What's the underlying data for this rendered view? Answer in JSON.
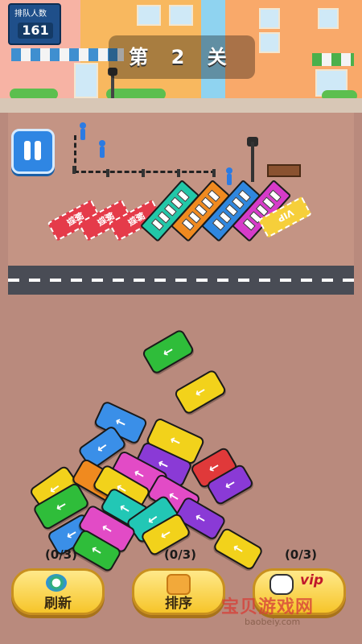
{
  "hud": {
    "queue_label": "排队人数",
    "queue_count": "161",
    "level_title": "第 2 关"
  },
  "parking": {
    "locked_slots": [
      "解锁",
      "解锁",
      "解锁"
    ],
    "bus_colors": [
      "#22c7a8",
      "#f08a1f",
      "#2f87df",
      "#d63bc9"
    ],
    "vip_slot": "VIP"
  },
  "vehicle_colors": {
    "green": "#2fbd3a",
    "yellow": "#f2d21b",
    "blue": "#3a8fe8",
    "purple": "#8a3ad6",
    "pink": "#e24bc6",
    "red": "#e0393a",
    "orange": "#f08a1f",
    "teal": "#22c7b5"
  },
  "actions": {
    "refresh": {
      "label": "刷新",
      "count": "(0/3)"
    },
    "sort": {
      "label": "排序",
      "count": "(0/3)"
    },
    "vip": {
      "label": "vip",
      "count": "(0/3)"
    }
  },
  "watermark": {
    "text": "宝贝游戏网",
    "url": "baobeiy.com"
  }
}
